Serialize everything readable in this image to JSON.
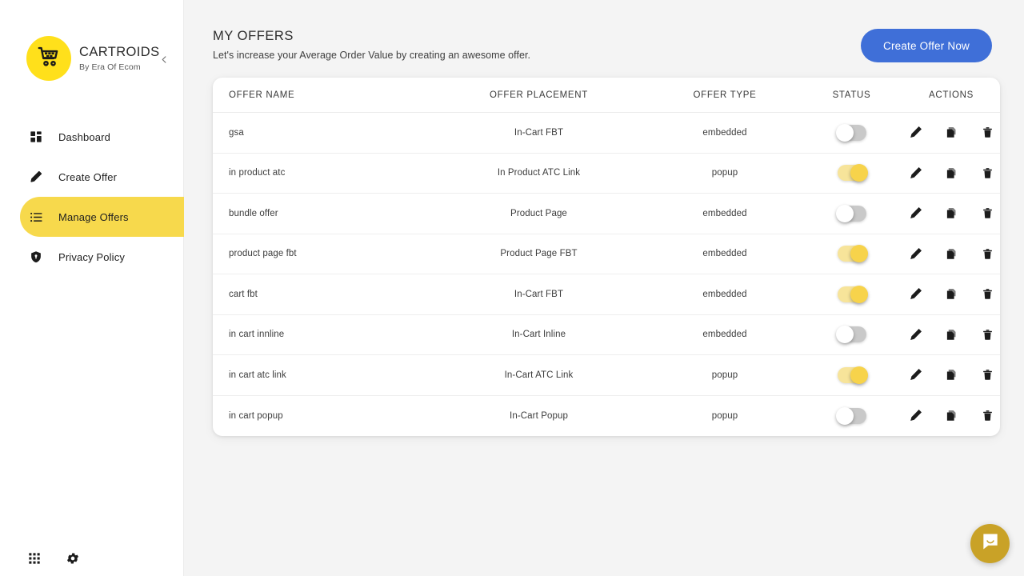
{
  "sidebar": {
    "brand": {
      "title": "CARTROIDS",
      "subtitle": "By Era Of Ecom",
      "logo_icon": "shopping-cart-icon",
      "logo_bg": "#ffe01b"
    },
    "collapse_icon": "chevron-left-icon",
    "items": [
      {
        "label": "Dashboard",
        "icon": "dashboard-grid-icon",
        "active": false
      },
      {
        "label": "Create Offer",
        "icon": "pencil-icon",
        "active": false
      },
      {
        "label": "Manage Offers",
        "icon": "list-icon",
        "active": true
      },
      {
        "label": "Privacy Policy",
        "icon": "shield-icon",
        "active": false
      }
    ],
    "active_bg": "#f7d94c",
    "footer": [
      {
        "icon": "apps-grid-icon"
      },
      {
        "icon": "gear-icon"
      }
    ]
  },
  "header": {
    "title": "MY OFFERS",
    "subtitle": "Let's increase your Average Order Value by creating an awesome offer.",
    "cta_label": "Create Offer Now",
    "cta_color": "#3f6fd8"
  },
  "table": {
    "columns": [
      "OFFER NAME",
      "OFFER PLACEMENT",
      "OFFER TYPE",
      "STATUS",
      "ACTIONS"
    ],
    "actions": [
      "edit-pencil-icon",
      "duplicate-copy-icon",
      "delete-trash-icon"
    ],
    "rows": [
      {
        "name": "gsa",
        "placement": "In-Cart FBT",
        "type": "embedded",
        "status": false
      },
      {
        "name": "in product atc",
        "placement": "In Product ATC Link",
        "type": "popup",
        "status": true
      },
      {
        "name": "bundle offer",
        "placement": "Product Page",
        "type": "embedded",
        "status": false
      },
      {
        "name": "product page fbt",
        "placement": "Product Page FBT",
        "type": "embedded",
        "status": true
      },
      {
        "name": "cart fbt",
        "placement": "In-Cart FBT",
        "type": "embedded",
        "status": true
      },
      {
        "name": "in cart innline",
        "placement": "In-Cart Inline",
        "type": "embedded",
        "status": false
      },
      {
        "name": "in cart atc link",
        "placement": "In-Cart ATC Link",
        "type": "popup",
        "status": true
      },
      {
        "name": "in cart popup",
        "placement": "In-Cart Popup",
        "type": "popup",
        "status": false
      }
    ]
  },
  "chat": {
    "icon": "chat-bubble-icon",
    "color": "#c9a227"
  }
}
